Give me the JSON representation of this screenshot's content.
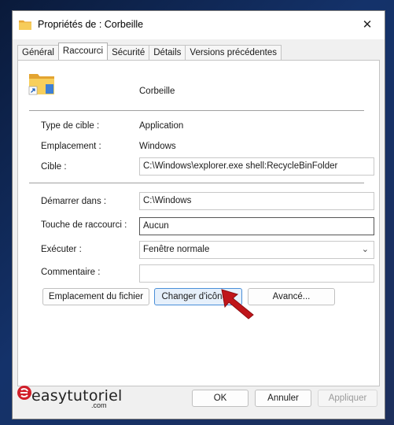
{
  "window": {
    "title": "Propriétés de : Corbeille",
    "close_label": "✕"
  },
  "tabs": [
    {
      "label": "Général"
    },
    {
      "label": "Raccourci"
    },
    {
      "label": "Sécurité"
    },
    {
      "label": "Détails"
    },
    {
      "label": "Versions précédentes"
    }
  ],
  "shortcut": {
    "name": "Corbeille",
    "target_type_label": "Type de cible :",
    "target_type_value": "Application",
    "location_label": "Emplacement :",
    "location_value": "Windows",
    "target_label": "Cible :",
    "target_value": "C:\\Windows\\explorer.exe shell:RecycleBinFolder",
    "start_in_label": "Démarrer dans :",
    "start_in_value": "C:\\Windows",
    "hotkey_label": "Touche de raccourci :",
    "hotkey_value": "Aucun",
    "run_label": "Exécuter :",
    "run_value": "Fenêtre normale",
    "comment_label": "Commentaire :",
    "comment_value": ""
  },
  "buttons": {
    "open_location": "Emplacement du fichier",
    "change_icon": "Changer d'icône...",
    "advanced": "Avancé...",
    "ok": "OK",
    "cancel": "Annuler",
    "apply": "Appliquer"
  },
  "watermark": {
    "brand": "easytutoriel",
    "sub": ".com"
  },
  "colors": {
    "arrow": "#c0151a",
    "folder": "#f2c14a",
    "accent": "#4a8fd8"
  }
}
